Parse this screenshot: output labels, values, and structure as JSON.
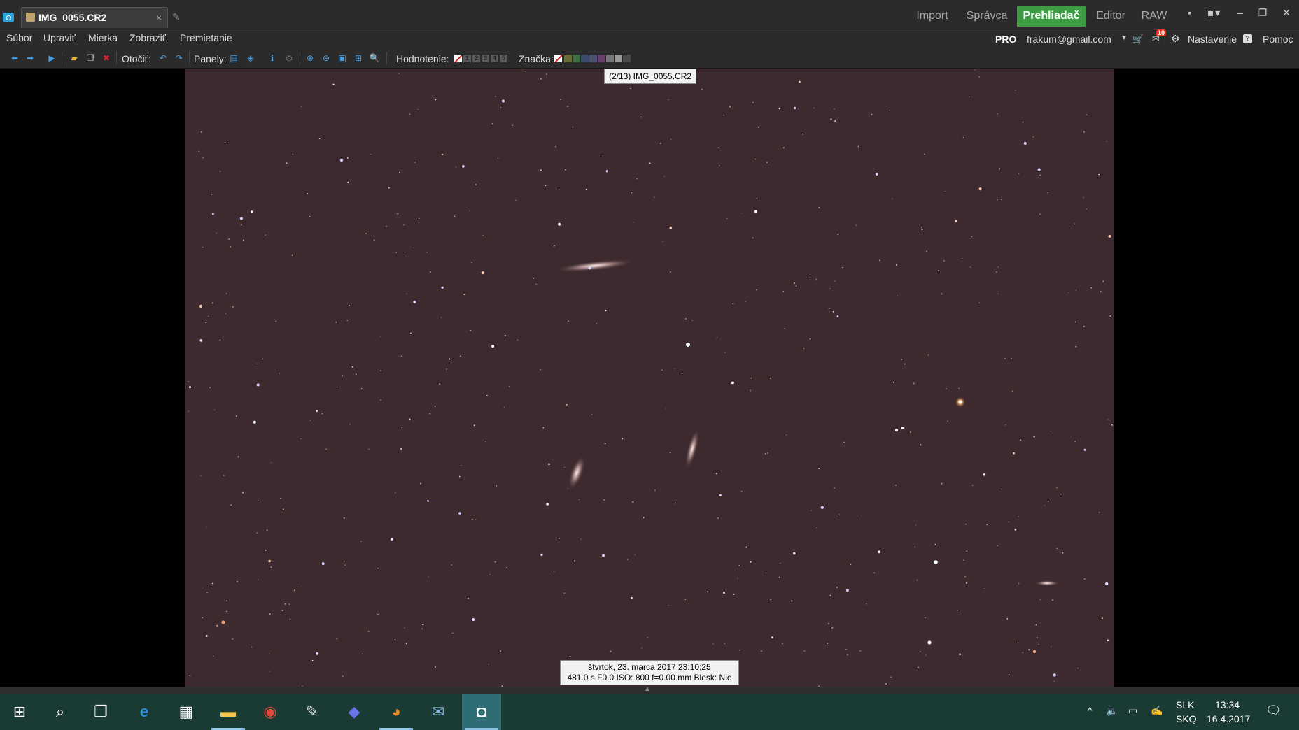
{
  "window": {
    "tab_title": "IMG_0055.CR2",
    "tab_close": "×",
    "modes": {
      "import": "Import",
      "spravca": "Správca",
      "prehliadac": "Prehliadač",
      "editor": "Editor",
      "raw": "RAW"
    },
    "controls": {
      "minimize": "–",
      "restore": "❐",
      "close": "✕"
    }
  },
  "menu": {
    "items": [
      "Súbor",
      "Upraviť",
      "Mierka",
      "Zobraziť",
      "Premietanie"
    ],
    "pro": "PRO",
    "account": "frakum@gmail.com",
    "notification_count": "10",
    "settings": "Nastavenie",
    "help": "Pomoc"
  },
  "toolbar": {
    "rotate_label": "Otočiť:",
    "panels_label": "Panely:",
    "rating_label": "Hodnotenie:",
    "ratings": [
      "1",
      "2",
      "3",
      "4",
      "5"
    ],
    "tag_label": "Značka:",
    "tag_colors": [
      "#6b6b3a",
      "#3f6d3f",
      "#3a4b6e",
      "#4f4f6f",
      "#6b3f6b",
      "#777777",
      "#9a9a9a",
      "#4a4a4a"
    ]
  },
  "viewer": {
    "file_caption": "(2/13) IMG_0055.CR2",
    "exif_line1": "štvrtok, 23. marca 2017 23:10:25",
    "exif_line2": "481.0 s F0.0 ISO: 800 f=0.00 mm Blesk: Nie"
  },
  "taskbar": {
    "lang_top": "SLK",
    "lang_bottom": "SKQ",
    "time": "13:34",
    "date": "16.4.2017"
  }
}
